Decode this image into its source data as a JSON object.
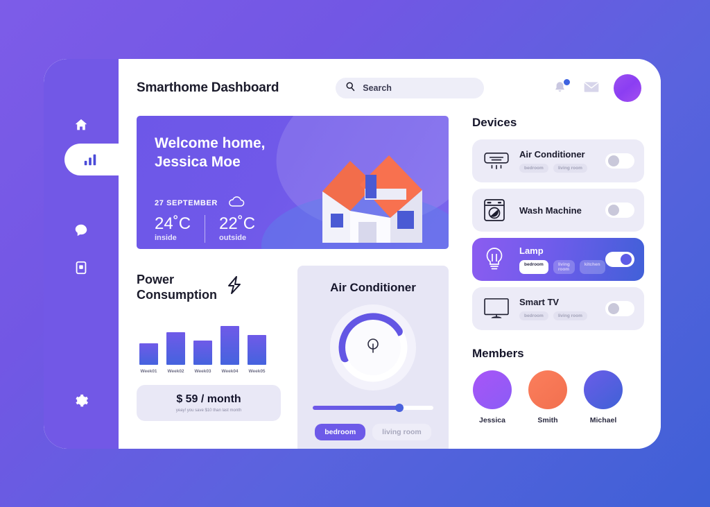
{
  "header": {
    "title": "Smarthome Dashboard",
    "search_placeholder": "Search",
    "bell_icon": "bell-icon",
    "mail_icon": "envelope-icon",
    "avatar": "user-avatar"
  },
  "sidebar": {
    "items": [
      {
        "icon": "home-icon",
        "active": false
      },
      {
        "icon": "bar-chart-icon",
        "active": true
      },
      {
        "icon": "chat-bubble-icon",
        "active": false
      },
      {
        "icon": "tablet-icon",
        "active": false
      }
    ],
    "settings": {
      "icon": "gear-icon"
    }
  },
  "welcome": {
    "greeting_line1": "Welcome home,",
    "greeting_line2": "Jessica Moe",
    "date": "27 SEPTEMBER",
    "weather_icon": "cloud-icon",
    "inside_temp": "24˚C",
    "inside_label": "inside",
    "outside_temp": "22˚C",
    "outside_label": "outside"
  },
  "power": {
    "title_line1": "Power",
    "title_line2": "Consumption",
    "icon": "lightning-bolt-icon",
    "cost_value": "$ 59 / month",
    "cost_note": "yeay! you save $10 than last month"
  },
  "chart_data": {
    "type": "bar",
    "title": "Power Consumption",
    "categories": [
      "Week01",
      "Week02",
      "Week03",
      "Week04",
      "Week05"
    ],
    "values": [
      40,
      60,
      45,
      72,
      55
    ],
    "xlabel": "",
    "ylabel": "",
    "ylim": [
      0,
      80
    ],
    "grid": false,
    "legend": "none",
    "series_color": "#5a5ce4"
  },
  "air_conditioner": {
    "title": "Air Conditioner",
    "dial_icon": "thermostat-knob-icon",
    "dial_percent": 62,
    "slider_percent": 72,
    "tabs": [
      {
        "label": "bedroom",
        "selected": true
      },
      {
        "label": "living room",
        "selected": false
      }
    ]
  },
  "devices": {
    "title": "Devices",
    "items": [
      {
        "name": "Air Conditioner",
        "icon": "air-conditioner-icon",
        "toggle": "off",
        "tags": [
          {
            "label": "bedroom",
            "selected": false
          },
          {
            "label": "living room",
            "selected": false
          }
        ]
      },
      {
        "name": "Wash Machine",
        "icon": "washing-machine-icon",
        "toggle": "off",
        "tags": []
      },
      {
        "name": "Lamp",
        "icon": "lightbulb-icon",
        "toggle": "on",
        "active": true,
        "tags": [
          {
            "label": "bedroom",
            "selected": true
          },
          {
            "label": "living room",
            "selected": false
          },
          {
            "label": "kitchen",
            "selected": false
          }
        ]
      },
      {
        "name": "Smart TV",
        "icon": "television-icon",
        "toggle": "off",
        "tags": [
          {
            "label": "bedroom",
            "selected": false
          },
          {
            "label": "living room",
            "selected": false
          }
        ]
      }
    ]
  },
  "members": {
    "title": "Members",
    "items": [
      {
        "name": "Jessica",
        "color_from": "#a855f7",
        "color_to": "#8b5cf6"
      },
      {
        "name": "Smith",
        "color_from": "#fb7e5c",
        "color_to": "#f2704f"
      },
      {
        "name": "Michael",
        "color_from": "#6b5ce8",
        "color_to": "#3f62d6"
      }
    ]
  },
  "theme": {
    "bg_from": "#7d5ce8",
    "bg_to": "#3f60d6",
    "accent": "#6d5ae8",
    "sidebar": "#7258e6"
  }
}
